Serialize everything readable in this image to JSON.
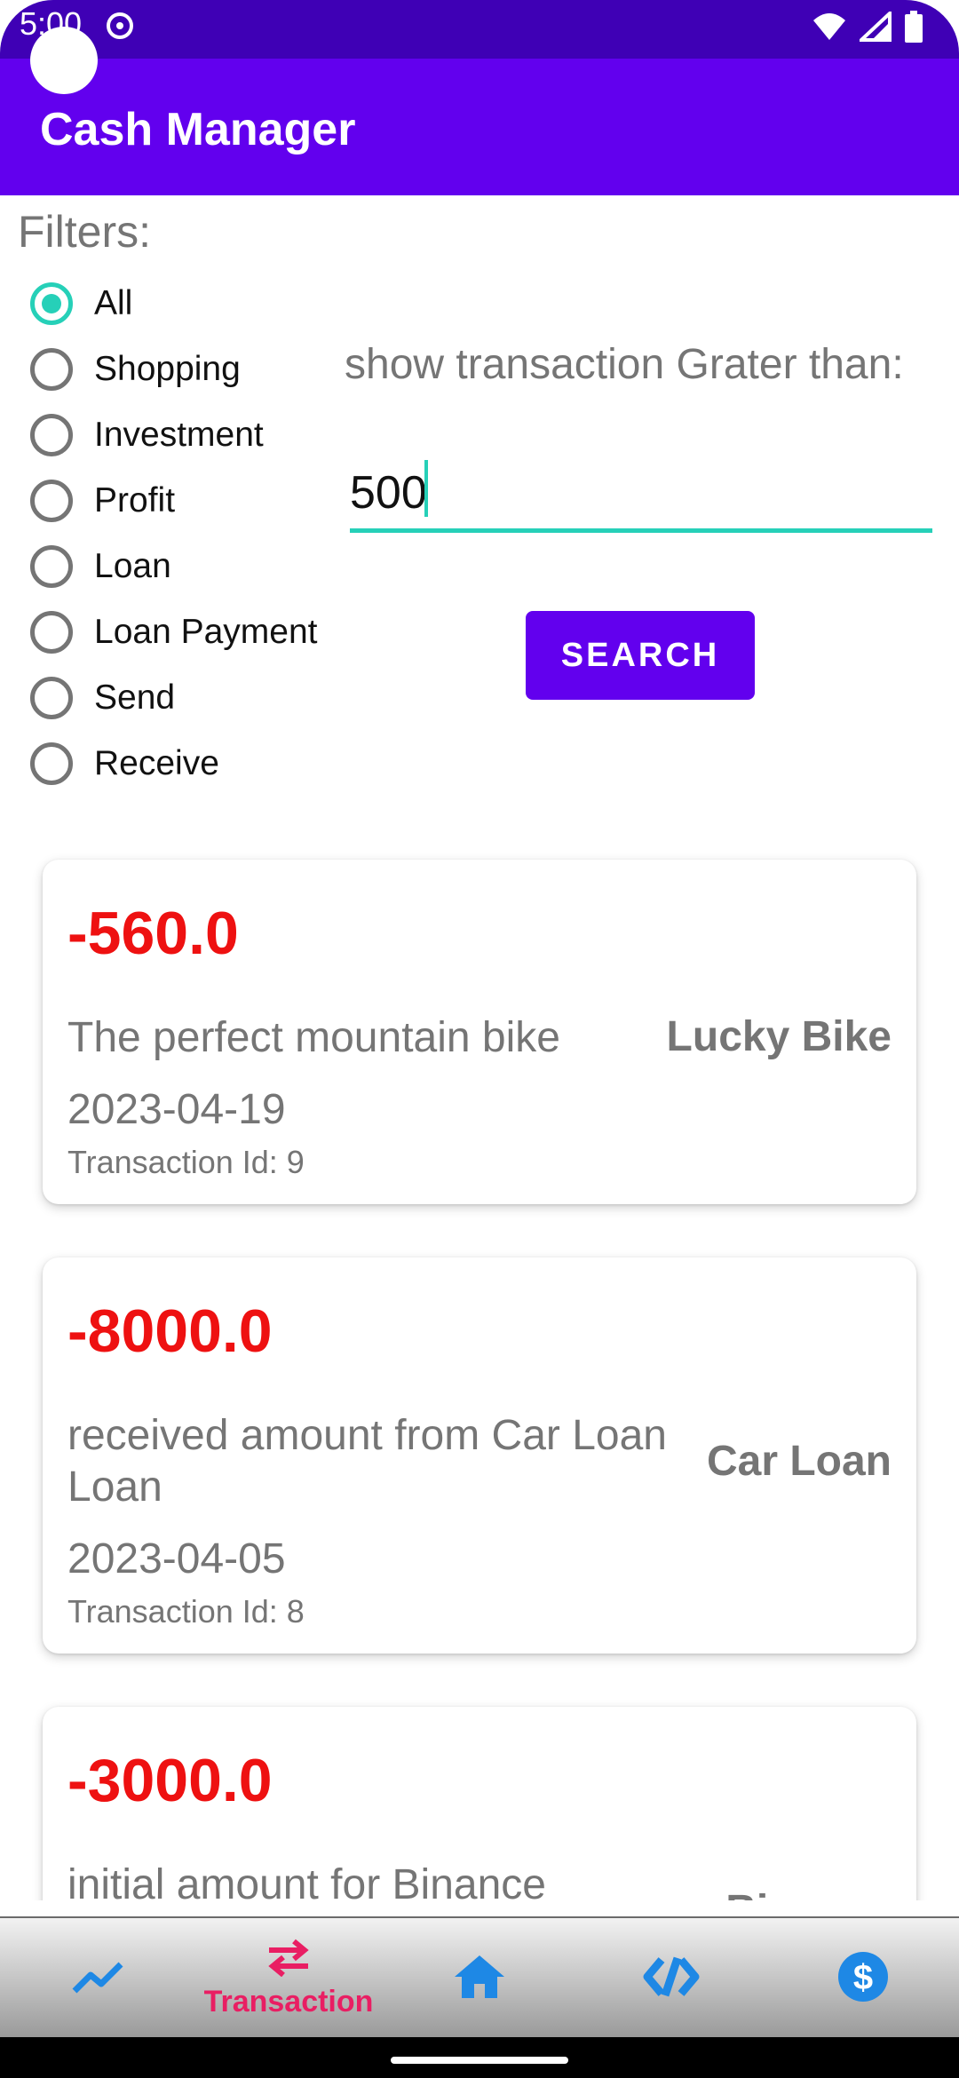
{
  "status_bar": {
    "time": "5:00"
  },
  "app_bar": {
    "title": "Cash Manager"
  },
  "filters": {
    "label": "Filters:",
    "options": [
      {
        "label": "All",
        "checked": true
      },
      {
        "label": "Shopping",
        "checked": false
      },
      {
        "label": "Investment",
        "checked": false
      },
      {
        "label": "Profit",
        "checked": false
      },
      {
        "label": "Loan",
        "checked": false
      },
      {
        "label": "Loan Payment",
        "checked": false
      },
      {
        "label": "Send",
        "checked": false
      },
      {
        "label": "Receive",
        "checked": false
      }
    ]
  },
  "threshold": {
    "label": "show transaction Grater than:",
    "value": "500",
    "button_label": "SEARCH"
  },
  "transactions": [
    {
      "amount": "-560.0",
      "description": "The perfect mountain bike",
      "name": "Lucky Bike",
      "date": "2023-04-19",
      "id_label": "Transaction Id: 9"
    },
    {
      "amount": "-8000.0",
      "description": "received amount from Car Loan Loan",
      "name": "Car Loan",
      "date": "2023-04-05",
      "id_label": "Transaction Id: 8"
    },
    {
      "amount": "-3000.0",
      "description": "initial amount for Binance",
      "name": "Binance",
      "date": "",
      "id_label": ""
    }
  ],
  "bottom_nav": {
    "items": [
      {
        "icon": "trending-up-icon",
        "label": ""
      },
      {
        "icon": "swap-arrows-icon",
        "label": "Transaction"
      },
      {
        "icon": "home-icon",
        "label": ""
      },
      {
        "icon": "code-icon",
        "label": ""
      },
      {
        "icon": "dollar-icon",
        "label": ""
      }
    ],
    "active_color": "#e91e63",
    "icon_color": "#1e88e5"
  },
  "colors": {
    "primary": "#6200ee",
    "primary_dark": "#3f00b5",
    "accent": "#26d0b8",
    "negative_amount": "#ee1111"
  }
}
